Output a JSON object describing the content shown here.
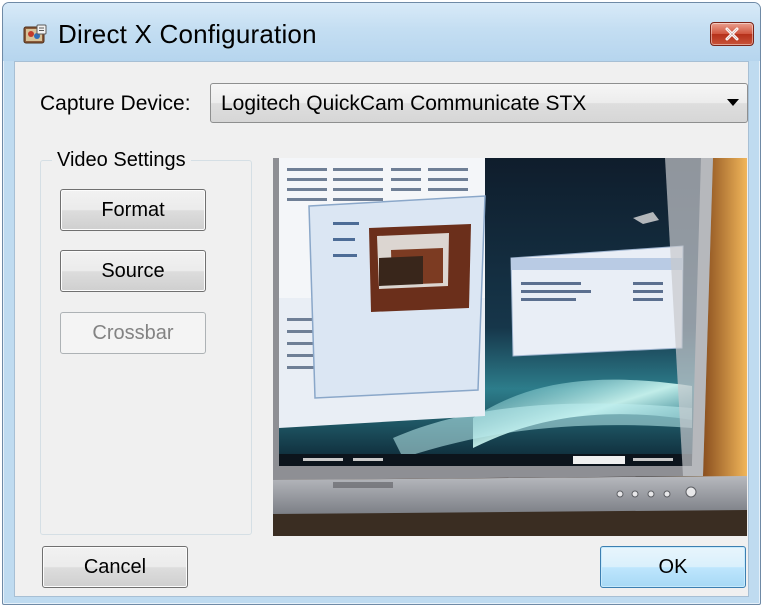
{
  "window": {
    "title": "Direct X Configuration",
    "icon": "directx-config-icon",
    "close_icon": "close-icon"
  },
  "capture": {
    "label": "Capture Device:",
    "selected_device": "Logitech QuickCam Communicate STX",
    "dropdown_icon": "chevron-down-icon"
  },
  "video_settings": {
    "legend": "Video Settings",
    "format_label": "Format",
    "source_label": "Source",
    "crossbar_label": "Crossbar",
    "crossbar_enabled": false
  },
  "preview": {
    "content": "webcam-preview-image"
  },
  "footer": {
    "cancel_label": "Cancel",
    "ok_label": "OK"
  },
  "colors": {
    "titlebar": "#c4def2",
    "client_bg": "#f0f0f0",
    "close_button": "#c9533a",
    "default_button_border": "#3c7fb1"
  }
}
